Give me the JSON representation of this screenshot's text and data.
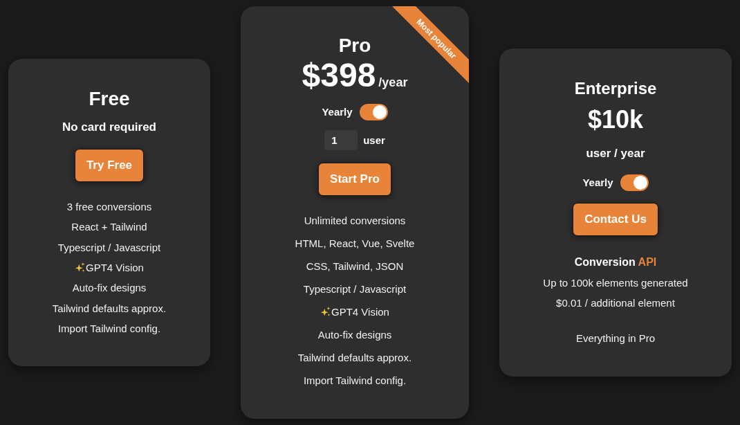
{
  "plans": [
    {
      "kind": "free",
      "name": "Free",
      "subtitle": "No card required",
      "button": "Try Free",
      "features": [
        {
          "kind": "plain",
          "text": "3 free conversions"
        },
        {
          "kind": "plain",
          "text": "React + Tailwind"
        },
        {
          "kind": "plain",
          "text": "Typescript / Javascript"
        },
        {
          "kind": "starred",
          "text": "GPT4 Vision"
        },
        {
          "kind": "plain",
          "text": "Auto-fix designs"
        },
        {
          "kind": "plain",
          "text": "Tailwind defaults approx."
        },
        {
          "kind": "plain",
          "text": "Import Tailwind config."
        }
      ]
    },
    {
      "kind": "pro",
      "badge": "Most popular",
      "name": "Pro",
      "price": "$398",
      "period": "/year",
      "billing": {
        "label": "Yearly",
        "on": true
      },
      "seats": {
        "value": "1",
        "unit": "user"
      },
      "button": "Start Pro",
      "features": [
        {
          "kind": "plain",
          "text": "Unlimited conversions"
        },
        {
          "kind": "plain",
          "text": "HTML, React, Vue, Svelte"
        },
        {
          "kind": "plain",
          "text": "CSS, Tailwind, JSON"
        },
        {
          "kind": "plain",
          "text": "Typescript / Javascript"
        },
        {
          "kind": "starred",
          "text": "GPT4 Vision"
        },
        {
          "kind": "plain",
          "text": "Auto-fix designs"
        },
        {
          "kind": "plain",
          "text": "Tailwind defaults approx."
        },
        {
          "kind": "plain",
          "text": "Import Tailwind config."
        }
      ]
    },
    {
      "kind": "enterprise",
      "name": "Enterprise",
      "price": "$10k",
      "subtitle": "user / year",
      "billing": {
        "label": "Yearly",
        "on": true
      },
      "button": "Contact Us",
      "heading": [
        {
          "text": "Conversion",
          "accent": false
        },
        {
          "text": "API",
          "accent": true
        }
      ],
      "features": [
        {
          "kind": "plain",
          "text": "Up to 100k elements generated"
        },
        {
          "kind": "plain",
          "text": "$0.01 / additional element"
        }
      ],
      "note": "Everything in Pro"
    }
  ]
}
